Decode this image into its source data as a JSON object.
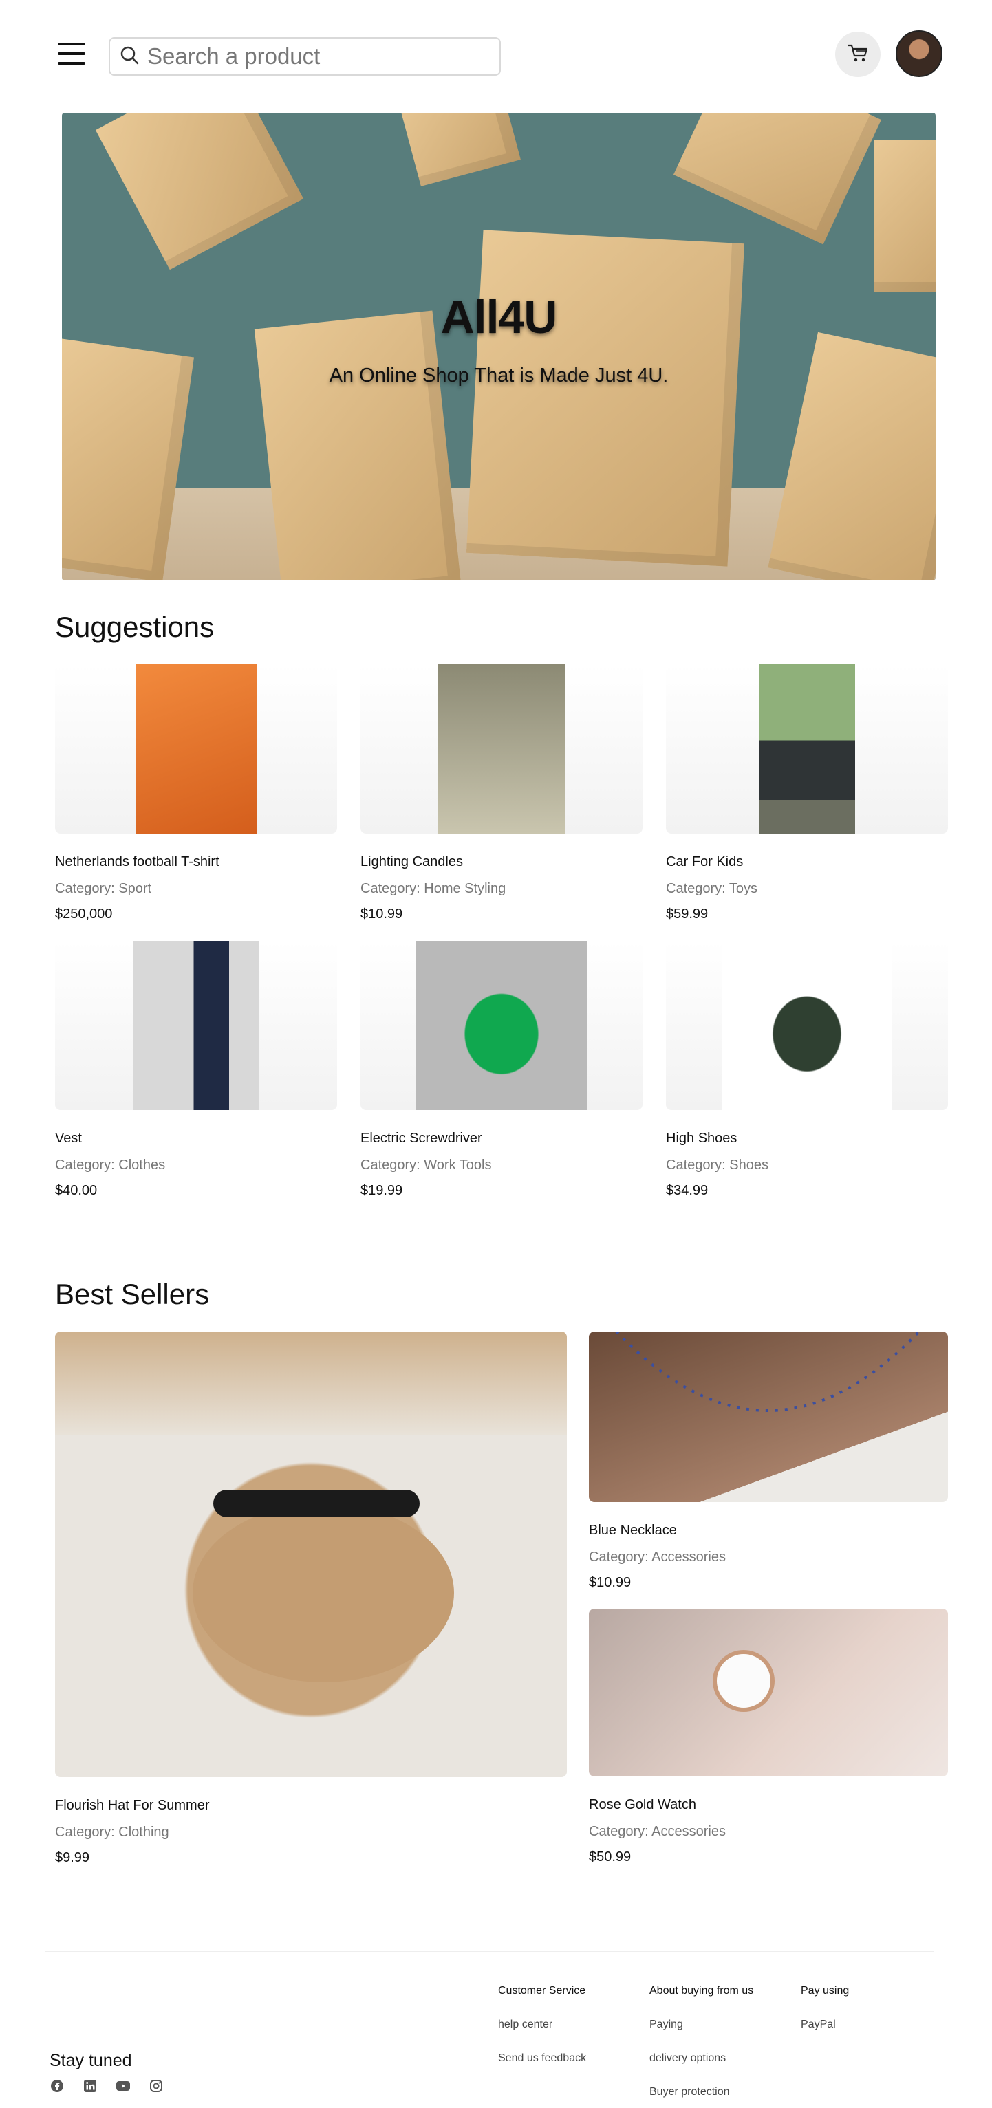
{
  "header": {
    "search_placeholder": "Search a product",
    "icons": [
      "menu-icon",
      "search-icon",
      "cart-icon",
      "avatar"
    ]
  },
  "hero": {
    "title": "All4U",
    "subtitle": "An Online Shop That is Made Just 4U."
  },
  "suggestions": {
    "title": "Suggestions",
    "items": [
      {
        "name": "Netherlands football T-shirt",
        "category": "Category: Sport",
        "price": "$250,000",
        "accent": "#e8742f"
      },
      {
        "name": "Lighting Candles",
        "category": "Category: Home Styling",
        "price": "$10.99",
        "accent": "#b7b59a"
      },
      {
        "name": "Car For Kids",
        "category": "Category: Toys",
        "price": "$59.99",
        "accent": "#2d3436"
      },
      {
        "name": "Vest",
        "category": "Category: Clothes",
        "price": "$40.00",
        "accent": "#1f2a44"
      },
      {
        "name": "Electric Screwdriver",
        "category": "Category: Work Tools",
        "price": "$19.99",
        "accent": "#10a84f"
      },
      {
        "name": "High Shoes",
        "category": "Category: Shoes",
        "price": "$34.99",
        "accent": "#2f4031"
      }
    ]
  },
  "best_sellers": {
    "title": "Best Sellers",
    "items": [
      {
        "name": "Flourish Hat For Summer",
        "category": "Category: Clothing",
        "price": "$9.99"
      },
      {
        "name": "Blue Necklace",
        "category": "Category: Accessories",
        "price": "$10.99"
      },
      {
        "name": "Rose Gold Watch",
        "category": "Category: Accessories",
        "price": "$50.99"
      }
    ]
  },
  "footer": {
    "stay_tuned": "Stay tuned",
    "socials": [
      "facebook-icon",
      "linkedin-icon",
      "youtube-icon",
      "instagram-icon"
    ],
    "columns": [
      {
        "heading": "Customer Service",
        "links": [
          "help center",
          "Send us feedback"
        ]
      },
      {
        "heading": "About buying from us",
        "links": [
          "Paying",
          "delivery options",
          "Buyer protection"
        ]
      },
      {
        "heading": "Pay using",
        "links": [
          "PayPal"
        ]
      }
    ]
  },
  "colors": {
    "hero_bg": "#587d7c",
    "box": "#d9b683",
    "text": "#111111",
    "muted": "#777777"
  }
}
